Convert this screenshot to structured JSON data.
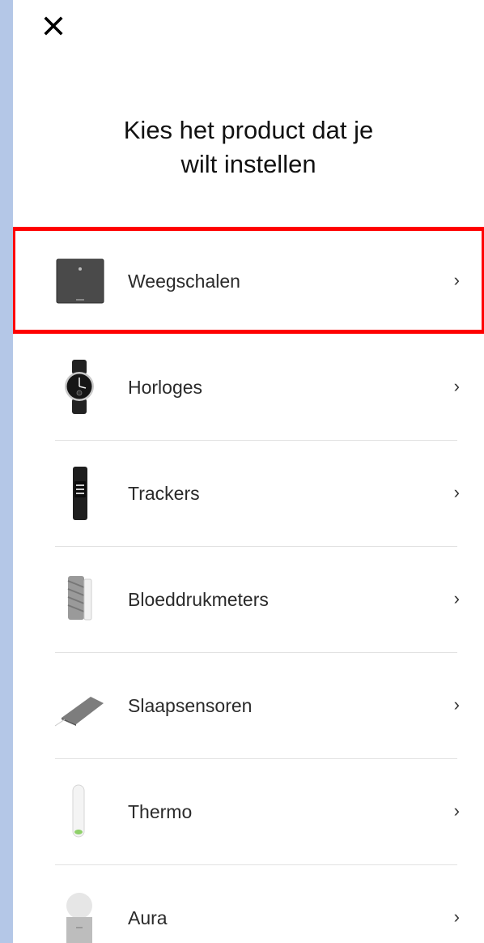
{
  "header": {
    "close_icon": "close-icon",
    "title_line1": "Kies het product dat je",
    "title_line2": "wilt instellen"
  },
  "products": [
    {
      "label": "Weegschalen",
      "icon": "scale-icon",
      "selected": true
    },
    {
      "label": "Horloges",
      "icon": "watch-icon",
      "selected": false
    },
    {
      "label": "Trackers",
      "icon": "tracker-icon",
      "selected": false
    },
    {
      "label": "Bloeddrukmeters",
      "icon": "blood-pressure-monitor-icon",
      "selected": false
    },
    {
      "label": "Slaapsensoren",
      "icon": "sleep-sensor-icon",
      "selected": false
    },
    {
      "label": "Thermo",
      "icon": "thermometer-icon",
      "selected": false
    },
    {
      "label": "Aura",
      "icon": "aura-icon",
      "selected": false
    }
  ],
  "chevron_glyph": "›",
  "colors": {
    "background_outer": "#b4c7e7",
    "panel": "#ffffff",
    "highlight": "#ff0000",
    "divider": "#e2e2e2",
    "text": "#2a2a2a"
  }
}
